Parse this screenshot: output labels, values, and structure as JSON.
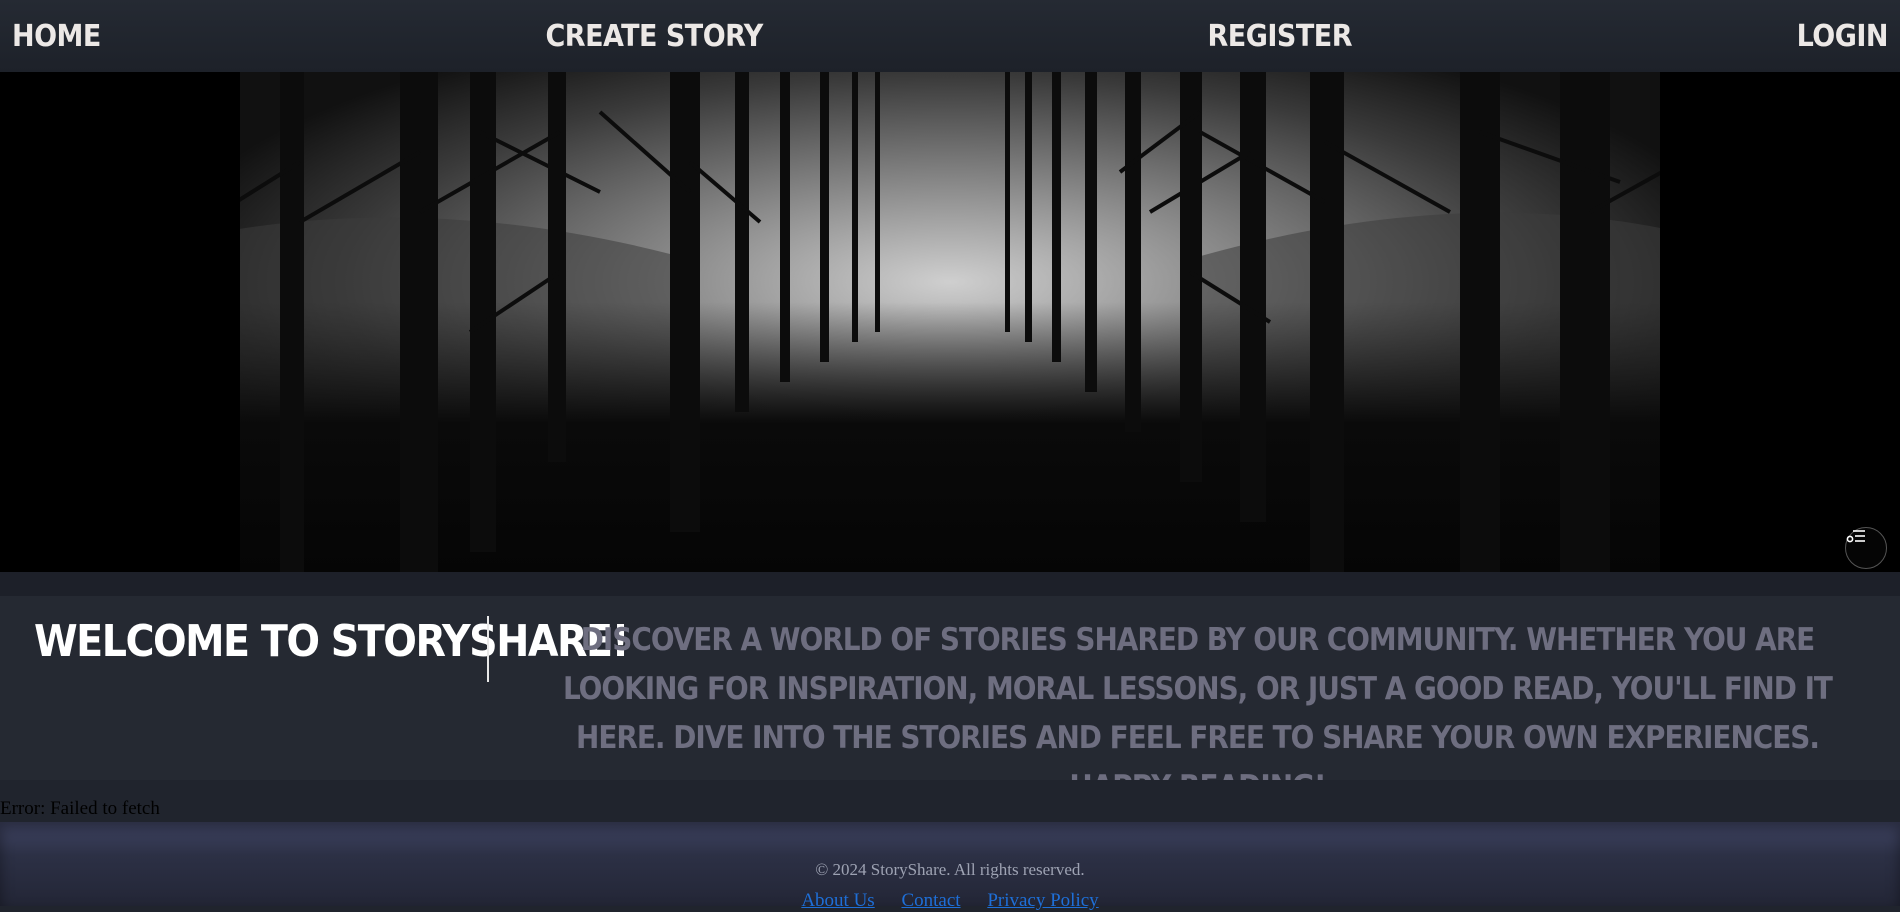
{
  "nav": {
    "home": "HOME",
    "create_story": "CREATE STORY",
    "register": "REGISTER",
    "login": "LOGIN"
  },
  "hero": {
    "image": "dark foggy forest road",
    "button_icon": "filter-list-icon"
  },
  "welcome": {
    "title": "WELCOME TO STORYSHARE!",
    "description": "DISCOVER A WORLD OF STORIES SHARED BY OUR COMMUNITY. WHETHER YOU ARE LOOKING FOR INSPIRATION, MORAL LESSONS, OR JUST A GOOD READ, YOU'LL FIND IT HERE. DIVE INTO THE STORIES AND FEEL FREE TO SHARE YOUR OWN EXPERIENCES. HAPPY READING!"
  },
  "status": {
    "error": "Error: Failed to fetch"
  },
  "footer": {
    "copyright": "© 2024 StoryShare. All rights reserved.",
    "links": [
      "About Us",
      "Contact",
      "Privacy Policy"
    ]
  },
  "colors": {
    "nav_text": "#ece8e6",
    "desc_text": "#6e6e80",
    "link": "#1e6fd8"
  }
}
